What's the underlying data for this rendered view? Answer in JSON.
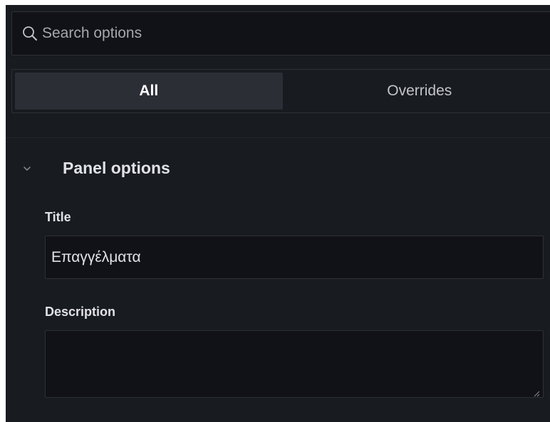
{
  "search": {
    "placeholder": "Search options",
    "value": "",
    "icon": "search-icon"
  },
  "tabs": [
    {
      "label": "All",
      "selected": true
    },
    {
      "label": "Overrides",
      "selected": false
    }
  ],
  "panel_options": {
    "title": "Panel options",
    "expanded": true,
    "icon": "chevron-down-icon",
    "fields": {
      "title": {
        "label": "Title",
        "value": "Επαγγέλματα"
      },
      "description": {
        "label": "Description",
        "value": ""
      }
    }
  },
  "colors": {
    "background": "#181b1f",
    "input_background": "#111217",
    "border": "#2e3036",
    "selected_tab": "#2b2e35",
    "text": "#e1e2e6",
    "muted_text": "#a6a7ae"
  }
}
